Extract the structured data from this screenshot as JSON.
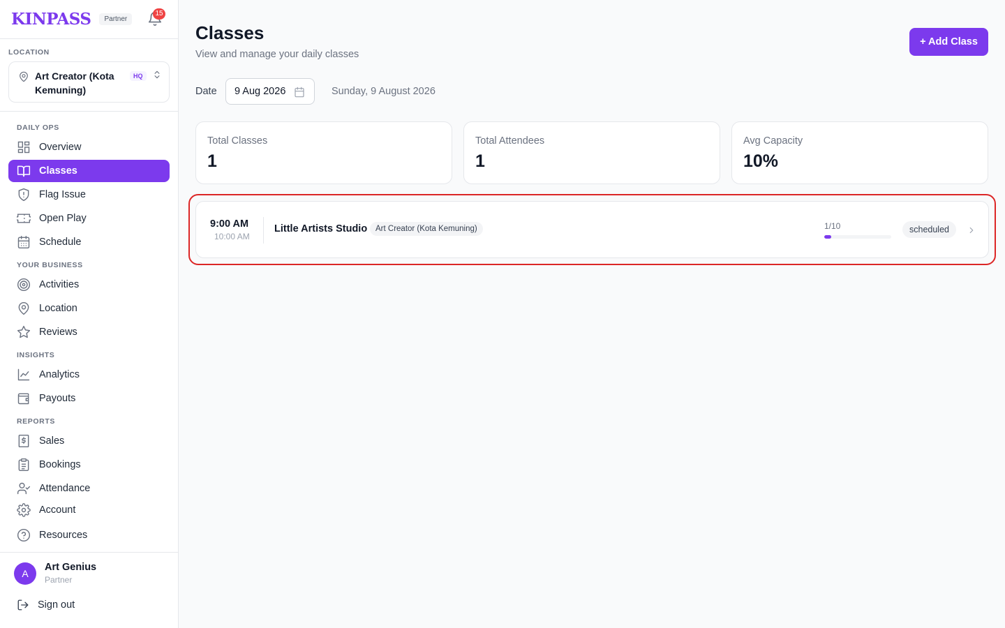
{
  "brand": {
    "logo": "KINPASS",
    "tag": "Partner",
    "notifications": "15"
  },
  "location": {
    "label": "LOCATION",
    "name": "Art Creator (Kota Kemuning)",
    "badge": "HQ"
  },
  "sidebar": {
    "sections": [
      {
        "title": "DAILY OPS"
      },
      {
        "title": "YOUR BUSINESS"
      },
      {
        "title": "INSIGHTS"
      },
      {
        "title": "REPORTS"
      }
    ],
    "items": [
      {
        "label": "Overview",
        "icon": "grid-icon"
      },
      {
        "label": "Classes",
        "icon": "book-open-icon",
        "active": true
      },
      {
        "label": "Flag Issue",
        "icon": "shield-alert-icon"
      },
      {
        "label": "Open Play",
        "icon": "ticket-icon"
      },
      {
        "label": "Schedule",
        "icon": "calendar-icon"
      },
      {
        "label": "Activities",
        "icon": "target-icon"
      },
      {
        "label": "Location",
        "icon": "map-pin-icon"
      },
      {
        "label": "Reviews",
        "icon": "star-icon"
      },
      {
        "label": "Analytics",
        "icon": "line-chart-icon"
      },
      {
        "label": "Payouts",
        "icon": "wallet-icon"
      },
      {
        "label": "Sales",
        "icon": "dollar-receipt-icon"
      },
      {
        "label": "Bookings",
        "icon": "clipboard-icon"
      },
      {
        "label": "Attendance",
        "icon": "user-check-icon"
      },
      {
        "label": "Account",
        "icon": "gear-icon"
      },
      {
        "label": "Resources",
        "icon": "help-circle-icon"
      }
    ]
  },
  "user": {
    "initial": "A",
    "name": "Art Genius",
    "role": "Partner",
    "signout": "Sign out"
  },
  "page": {
    "title": "Classes",
    "subtitle": "View and manage your daily classes",
    "add_button": "+ Add Class",
    "date_label": "Date",
    "date_value": "9 Aug 2026",
    "date_long": "Sunday, 9 August 2026"
  },
  "stats": [
    {
      "label": "Total Classes",
      "value": "1"
    },
    {
      "label": "Total Attendees",
      "value": "1"
    },
    {
      "label": "Avg Capacity",
      "value": "10%"
    }
  ],
  "classes": [
    {
      "start": "9:00 AM",
      "end": "10:00 AM",
      "name": "Little Artists Studio",
      "location": "Art Creator (Kota Kemuning)",
      "capacity_text": "1/10",
      "capacity_fraction": 0.1,
      "status": "scheduled"
    }
  ],
  "colors": {
    "accent": "#7c3aed",
    "highlight": "#dc2626",
    "badge": "#ef4444"
  }
}
